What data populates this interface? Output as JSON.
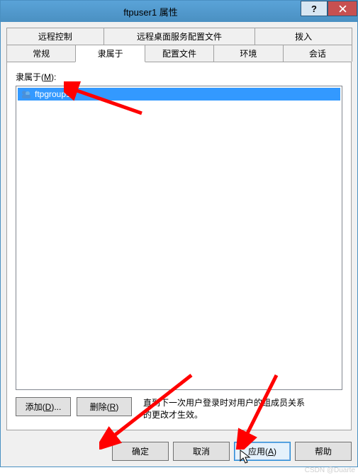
{
  "window": {
    "title": "ftpuser1 属性"
  },
  "tabs": {
    "row1": [
      "远程控制",
      "远程桌面服务配置文件",
      "拨入"
    ],
    "row2": [
      "常规",
      "隶属于",
      "配置文件",
      "环境",
      "会话"
    ],
    "active": "隶属于"
  },
  "pane": {
    "label_prefix": "隶属于(",
    "label_ul": "M",
    "label_suffix": "):",
    "items": [
      {
        "name": "ftpgroup1",
        "selected": true
      }
    ],
    "add_btn_prefix": "添加(",
    "add_btn_ul": "D",
    "add_btn_suffix": ")...",
    "remove_btn_prefix": "删除(",
    "remove_btn_ul": "R",
    "remove_btn_suffix": ")",
    "note": "直到下一次用户登录时对用户的组成员关系的更改才生效。"
  },
  "footer": {
    "ok": "确定",
    "cancel": "取消",
    "apply_prefix": "应用(",
    "apply_ul": "A",
    "apply_suffix": ")",
    "help": "帮助"
  },
  "watermark": "CSDN @Duarte"
}
